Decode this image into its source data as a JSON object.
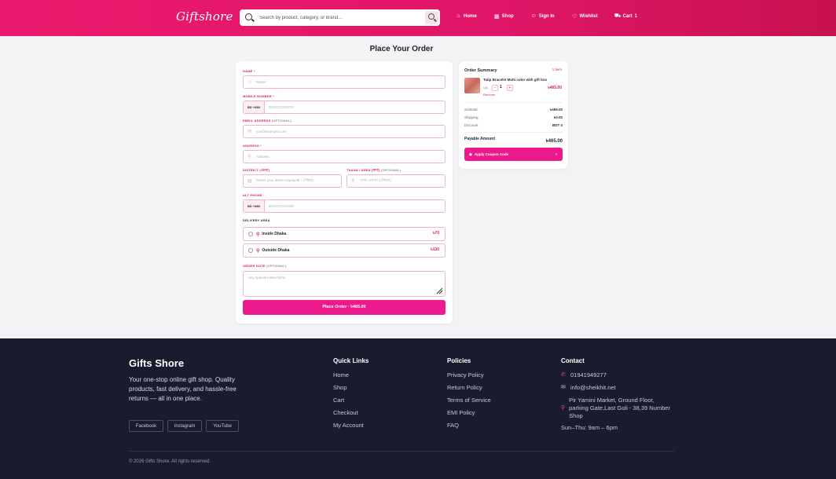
{
  "header": {
    "logo": "Giftshore",
    "search_placeholder": "Search by product, category, or brand...",
    "nav": [
      {
        "icon": "home-icon",
        "label": "Home"
      },
      {
        "icon": "grid-icon",
        "label": "Shop"
      },
      {
        "icon": "user-icon",
        "label": "Sign In"
      },
      {
        "icon": "heart-icon",
        "label": "Wishlist"
      },
      {
        "icon": "cart-icon",
        "label": "Cart",
        "badge": "1"
      }
    ]
  },
  "page_title": "Place Your Order",
  "form": {
    "name": {
      "label": "NAME",
      "required": "*",
      "placeholder": "Name"
    },
    "mobile": {
      "label": "MOBILE NUMBER",
      "required": "*",
      "prefix": "+880",
      "flag": "BD",
      "placeholder": "01XXXXXXXXX"
    },
    "email": {
      "label": "EMAIL ADDRESS",
      "optional": "(OPTIONAL)",
      "placeholder": "you@example.com"
    },
    "address": {
      "label": "ADDRESS",
      "required": "*",
      "placeholder": "Address"
    },
    "district": {
      "label": "DISTRICT (জেলা)",
      "placeholder": "Select your district (optional / ঐচ্ছিক)"
    },
    "thana": {
      "label": "THANA / AREA (থানা)",
      "optional": "(OPTIONAL)",
      "placeholder": "থানা/ এলাকা (ঐচ্ছিক)"
    },
    "alt_phone": {
      "label": "ALT PHONE",
      "prefix": "+880",
      "flag": "BD",
      "placeholder": "01XXXXXXXXX"
    },
    "delivery": {
      "label": "DELIVERY AREA",
      "options": [
        {
          "name": "Inside Dhaka",
          "price": "৳70"
        },
        {
          "name": "Outside Dhaka",
          "price": "৳130"
        }
      ]
    },
    "note": {
      "label": "ORDER NOTE",
      "optional": "(OPTIONAL)",
      "placeholder": "Any special instructions"
    },
    "submit_label": "Place Order · ৳465.00"
  },
  "summary": {
    "title": "Order Summary",
    "count": "1 item",
    "product": {
      "name": "Tulip Bracelet Multi color with gift box",
      "qty_label": "Qty",
      "qty": "1",
      "price": "৳465.00",
      "remove_label": "Remove"
    },
    "rows": [
      {
        "label": "Subtotal",
        "value": "৳465.00"
      },
      {
        "label": "Shipping",
        "value": "৳0.00"
      },
      {
        "label": "Discount",
        "value": "BDT 0"
      }
    ],
    "payable_label": "Payable Amount",
    "payable_value": "৳465.00",
    "coupon_label": "Apply Coupon Code"
  },
  "footer": {
    "brand": "Gifts Shore",
    "description": "Your one-stop online gift shop. Quality products, fast delivery, and hassle-free returns — all in one place.",
    "social": [
      "Facebook",
      "Instagram",
      "YouTube"
    ],
    "quick_links": {
      "title": "Quick Links",
      "items": [
        "Home",
        "Shop",
        "Cart",
        "Checkout",
        "My Account"
      ]
    },
    "policies": {
      "title": "Policies",
      "items": [
        "Privacy Policy",
        "Return Policy",
        "Terms of Service",
        "EMI Policy",
        "FAQ"
      ]
    },
    "contact": {
      "title": "Contact",
      "phone": "01941949277",
      "email": "info@sheikhit.net",
      "address": "Pir Yamini Market, Ground Floor, parking Gate,Last Goli - 38,39 Number Shop",
      "hours": "Sun–Thu: 9am – 6pm"
    },
    "copyright": "© 2026 Gifts Shore. All rights reserved."
  },
  "colors": {
    "accent": "#ec1a8c",
    "header": "#e01668",
    "footer_bg": "#1a1b2e"
  }
}
